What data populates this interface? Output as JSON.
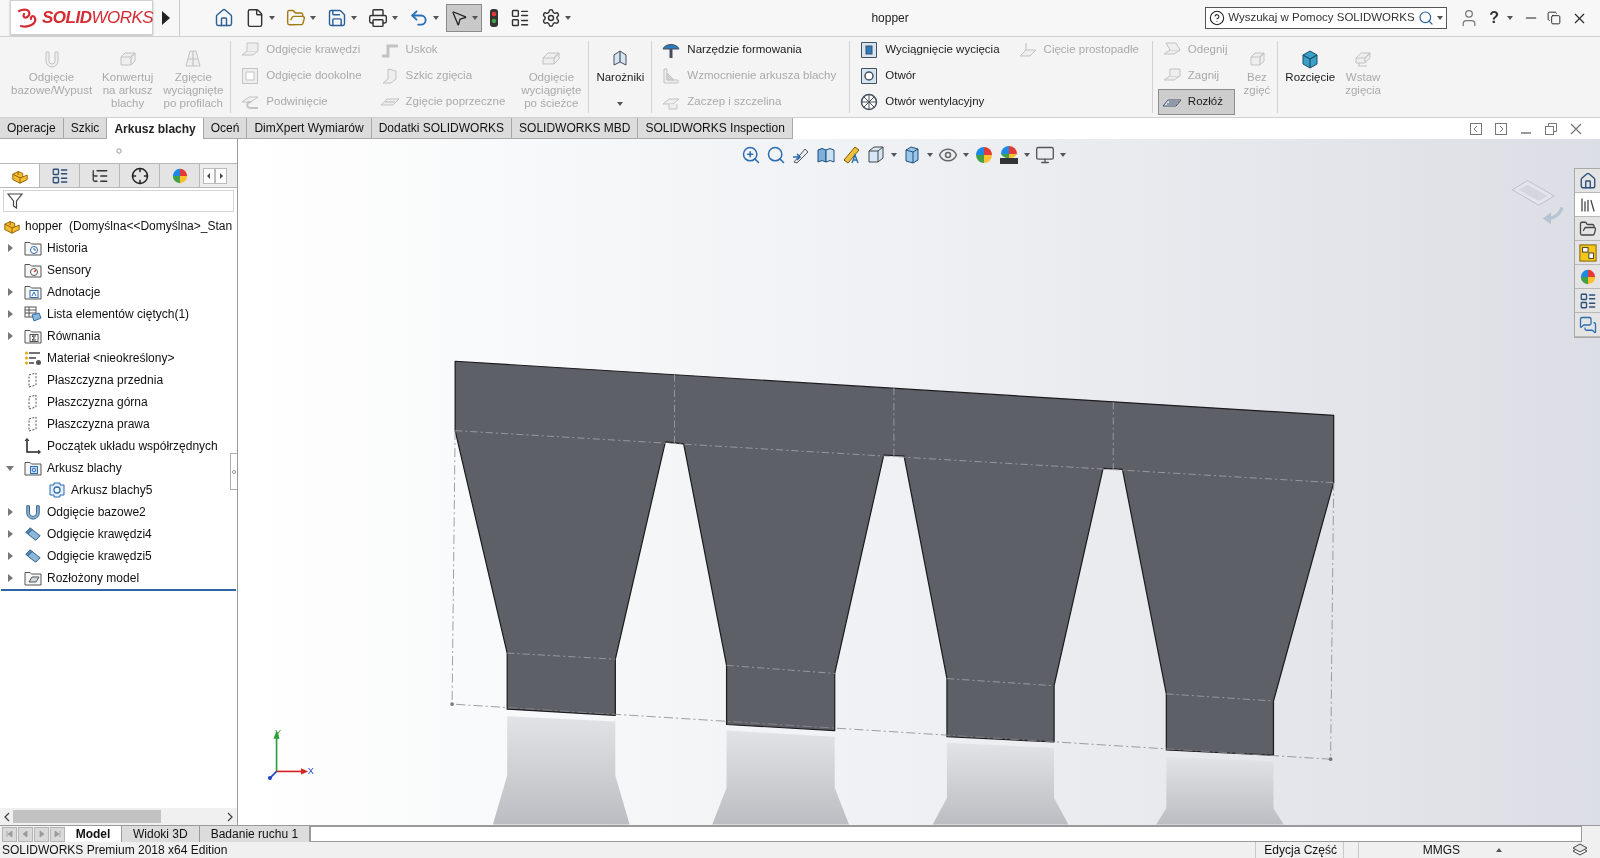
{
  "app": {
    "logo": "**SOLID**WORKS",
    "title": "hopper"
  },
  "quick_access": [
    {
      "kind": "home",
      "dropdown": false,
      "pressed": false
    },
    {
      "kind": "new",
      "dropdown": true,
      "pressed": false
    },
    {
      "kind": "open",
      "dropdown": true,
      "pressed": false
    },
    {
      "kind": "save",
      "dropdown": true,
      "pressed": false
    },
    {
      "kind": "print",
      "dropdown": true,
      "pressed": false
    },
    {
      "kind": "undo",
      "dropdown": true,
      "pressed": false
    },
    {
      "kind": "select",
      "dropdown": true,
      "pressed": true
    },
    {
      "kind": "rebuild",
      "dropdown": false,
      "pressed": false
    },
    {
      "kind": "options",
      "dropdown": false,
      "pressed": false
    },
    {
      "kind": "settings",
      "dropdown": true,
      "pressed": false
    }
  ],
  "search": {
    "placeholder": "Wyszukaj w Pomocy SOLIDWORKS"
  },
  "help": "?",
  "ribbon": [
    {
      "columns": [
        {
          "kind": "large",
          "items": [
            {
              "lines": [
                "Odgięcie",
                "bazowe/Wypust"
              ],
              "kind": "baseflange",
              "disabled": true,
              "dropdown": false
            }
          ]
        },
        {
          "kind": "large",
          "items": [
            {
              "lines": [
                "Konwertuj",
                "na arkusz",
                "blachy"
              ],
              "kind": "convert",
              "disabled": true,
              "dropdown": false
            }
          ]
        },
        {
          "kind": "large",
          "items": [
            {
              "lines": [
                "Zgięcie",
                "wyciągnięte",
                "po profilach"
              ],
              "kind": "loftedbend",
              "disabled": true,
              "dropdown": false
            }
          ]
        }
      ]
    },
    {
      "columns": [
        {
          "kind": "stack",
          "items": [
            {
              "label": "Odgięcie krawędzi",
              "kind": "edgeflange",
              "disabled": true,
              "pressed": false
            },
            {
              "label": "Odgięcie dookolne",
              "kind": "miterflange",
              "disabled": true,
              "pressed": false
            },
            {
              "label": "Podwinięcie",
              "kind": "hem",
              "disabled": true,
              "pressed": false
            }
          ]
        },
        {
          "kind": "stack",
          "items": [
            {
              "label": "Uskok",
              "kind": "jog",
              "disabled": true,
              "pressed": false
            },
            {
              "label": "Szkic zgięcia",
              "kind": "sketchedbend",
              "disabled": true,
              "pressed": false
            },
            {
              "label": "Zgięcie poprzeczne",
              "kind": "crossbreak",
              "disabled": true,
              "pressed": false
            }
          ]
        },
        {
          "kind": "large",
          "items": [
            {
              "lines": [
                "Odgięcie",
                "wyciągnięte",
                "po ścieżce"
              ],
              "kind": "sweptflange",
              "disabled": true,
              "dropdown": false
            }
          ]
        }
      ]
    },
    {
      "columns": [
        {
          "kind": "large",
          "items": [
            {
              "lines": [
                "Narożniki"
              ],
              "kind": "corners",
              "disabled": false,
              "dropdown": true
            }
          ]
        }
      ]
    },
    {
      "columns": [
        {
          "kind": "stack",
          "items": [
            {
              "label": "Narzędzie formowania",
              "kind": "formingtool",
              "disabled": false,
              "pressed": false
            },
            {
              "label": "Wzmocnienie arkusza blachy",
              "kind": "gusset",
              "disabled": true,
              "pressed": false
            },
            {
              "label": "Zaczep i szczelina",
              "kind": "tabslot",
              "disabled": true,
              "pressed": false
            }
          ]
        }
      ]
    },
    {
      "columns": [
        {
          "kind": "stack",
          "items": [
            {
              "label": "Wyciągnięcie wycięcia",
              "kind": "extrudedcut",
              "disabled": false,
              "pressed": false
            },
            {
              "label": "Otwór",
              "kind": "hole",
              "disabled": false,
              "pressed": false
            },
            {
              "label": "Otwór wentylacyjny",
              "kind": "vent",
              "disabled": false,
              "pressed": false
            }
          ]
        },
        {
          "kind": "stack",
          "items": [
            {
              "label": "Cięcie prostopadłe",
              "kind": "normalcut",
              "disabled": true,
              "pressed": false
            }
          ]
        }
      ]
    },
    {
      "columns": [
        {
          "kind": "stack",
          "items": [
            {
              "label": "Odegnij",
              "kind": "unfold",
              "disabled": true,
              "pressed": false
            },
            {
              "label": "Zagnij",
              "kind": "fold",
              "disabled": true,
              "pressed": false
            },
            {
              "label": "Rozłóż",
              "kind": "flatten",
              "disabled": false,
              "pressed": true
            }
          ]
        },
        {
          "kind": "large",
          "items": [
            {
              "lines": [
                "Bez",
                "zgięć"
              ],
              "kind": "nobends",
              "disabled": true,
              "dropdown": false
            }
          ]
        }
      ]
    },
    {
      "columns": [
        {
          "kind": "large",
          "items": [
            {
              "lines": [
                "Rozcięcie"
              ],
              "kind": "rip",
              "disabled": false,
              "dropdown": false
            }
          ]
        },
        {
          "kind": "large",
          "items": [
            {
              "lines": [
                "Wstaw",
                "zgięcia"
              ],
              "kind": "insertbends",
              "disabled": true,
              "dropdown": false
            }
          ]
        }
      ]
    }
  ],
  "command_tabs": [
    {
      "label": "Operacje",
      "selected": false
    },
    {
      "label": "Szkic",
      "selected": false
    },
    {
      "label": "Arkusz blachy",
      "selected": true
    },
    {
      "label": "Oceń",
      "selected": false
    },
    {
      "label": "DimXpert Wymiarów",
      "selected": false
    },
    {
      "label": "Dodatki SOLIDWORKS",
      "selected": false
    },
    {
      "label": "SOLIDWORKS MBD",
      "selected": false
    },
    {
      "label": "SOLIDWORKS Inspection",
      "selected": false
    }
  ],
  "feature_manager": {
    "tabs": [
      {
        "kind": "tree",
        "selected": true
      },
      {
        "kind": "properties",
        "selected": false
      },
      {
        "kind": "configurations",
        "selected": false
      },
      {
        "kind": "dimxpert",
        "selected": false
      },
      {
        "kind": "display",
        "selected": false
      }
    ],
    "root": "hopper  (Domyślna<<Domyślna>_Stan",
    "items": [
      {
        "label": "Historia",
        "kind": "history",
        "expanded": false
      },
      {
        "label": "Sensory",
        "kind": "sensors"
      },
      {
        "label": "Adnotacje",
        "kind": "annotations",
        "expanded": false
      },
      {
        "label": "Lista elementów ciętych(1)",
        "kind": "cutlist",
        "expanded": false
      },
      {
        "label": "Równania",
        "kind": "equations",
        "expanded": false
      },
      {
        "label": "Materiał <nieokreślony>",
        "kind": "material"
      },
      {
        "label": "Płaszczyzna przednia",
        "kind": "plane"
      },
      {
        "label": "Płaszczyzna górna",
        "kind": "plane"
      },
      {
        "label": "Płaszczyzna prawa",
        "kind": "plane"
      },
      {
        "label": "Początek układu współrzędnych",
        "kind": "origin"
      },
      {
        "label": "Arkusz blachy",
        "kind": "sheetmetal",
        "expanded": true,
        "children": [
          {
            "label": "Arkusz blachy5",
            "kind": "sheetmetalfeature"
          }
        ]
      },
      {
        "label": "Odgięcie bazowe2",
        "kind": "baseflange",
        "expanded": false
      },
      {
        "label": "Odgięcie krawędzi4",
        "kind": "edgeflange",
        "expanded": false
      },
      {
        "label": "Odgięcie krawędzi5",
        "kind": "edgeflange",
        "expanded": false
      },
      {
        "label": "Rozłożony model",
        "kind": "flatpattern",
        "expanded": false
      }
    ]
  },
  "task_pane": [
    {
      "kind": "home",
      "selected": false
    },
    {
      "kind": "library",
      "selected": true
    },
    {
      "kind": "folder",
      "selected": false
    },
    {
      "kind": "palette",
      "selected": false
    },
    {
      "kind": "appearances",
      "selected": false
    },
    {
      "kind": "properties",
      "selected": false
    },
    {
      "kind": "forum",
      "selected": false
    }
  ],
  "triad": {
    "y": "Y",
    "x": "X"
  },
  "model_tabs": [
    {
      "label": "Model",
      "selected": true
    },
    {
      "label": "Widoki 3D",
      "selected": false
    },
    {
      "label": "Badanie ruchu 1",
      "selected": false
    }
  ],
  "status_bar": {
    "edition": "SOLIDWORKS Premium 2018 x64 Edition",
    "mode": "Edycja Część",
    "units": "MMGS"
  }
}
